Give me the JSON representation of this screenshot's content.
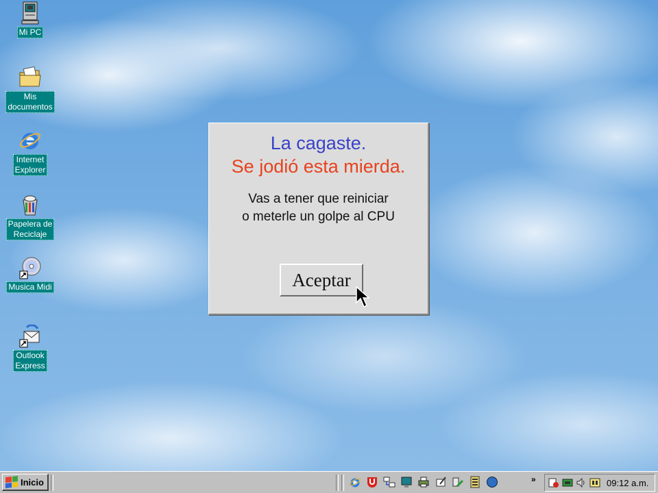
{
  "desktop": {
    "icons": [
      {
        "label": "Mi PC",
        "icon": "computer-icon"
      },
      {
        "label": "Mis\ndocumentos",
        "icon": "folder-documents-icon"
      },
      {
        "label": "Internet\nExplorer",
        "icon": "internet-explorer-icon"
      },
      {
        "label": "Papelera de\nReciclaje",
        "icon": "recycle-bin-icon"
      },
      {
        "label": "Musica Midi",
        "icon": "cd-music-icon"
      },
      {
        "label": "Outlook\nExpress",
        "icon": "outlook-express-icon"
      }
    ]
  },
  "dialog": {
    "title": "La cagaste.",
    "subtitle": "Se jodió esta mierda.",
    "message_line1": "Vas a tener que reiniciar",
    "message_line2": "o meterle un golpe al CPU",
    "ok_button": "Aceptar",
    "colors": {
      "title": "#3a42c8",
      "subtitle": "#e8421e",
      "background": "#dcdcdc"
    }
  },
  "taskbar": {
    "start_label": "Inicio",
    "quick_launch": [
      "internet-explorer-icon",
      "antivirus-icon",
      "network-icon",
      "monitor-icon",
      "printer-icon",
      "pen-icon",
      "tools-icon",
      "document-icon",
      "globe-icon"
    ],
    "chevron": "»",
    "tray_icons": [
      "speaker-tray-icon",
      "display-tray-icon",
      "volume-icon",
      "task-scheduler-icon"
    ],
    "clock": "09:12 a.m."
  }
}
